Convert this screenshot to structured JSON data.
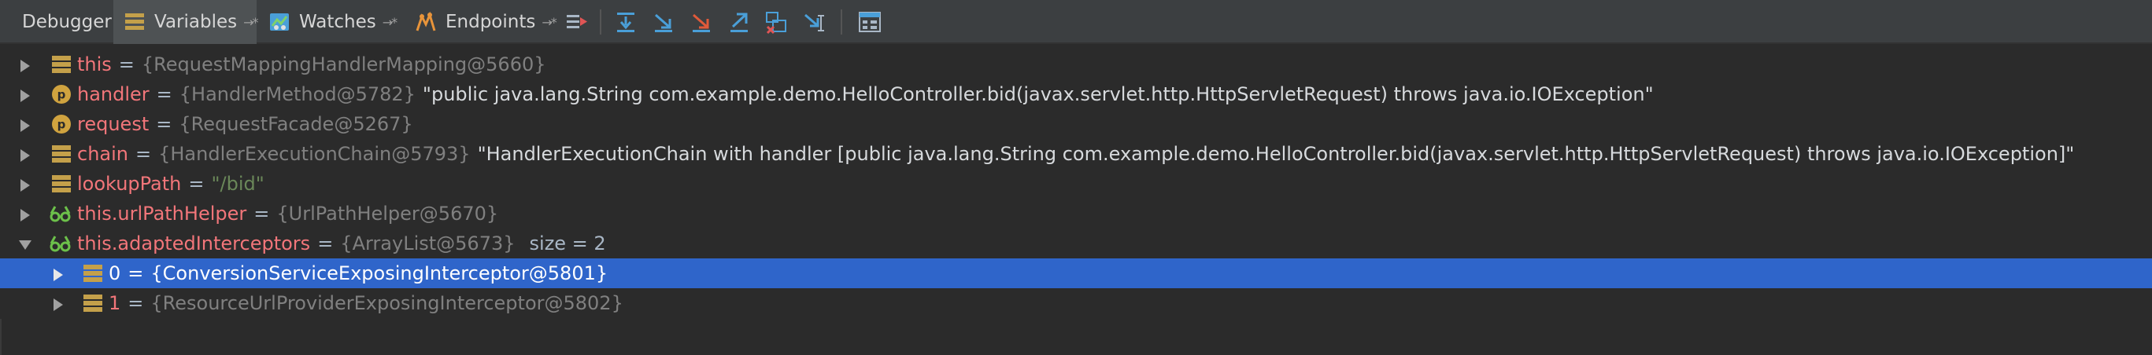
{
  "toolbar": {
    "tabs": [
      {
        "label": "Debugger"
      },
      {
        "label": "Variables",
        "pin": "→*"
      },
      {
        "label": "Watches",
        "pin": "→*"
      },
      {
        "label": "Endpoints",
        "pin": "→*"
      }
    ]
  },
  "variables": [
    {
      "name": "this",
      "eq": "=",
      "value": "{RequestMappingHandlerMapping@5660}",
      "extra": "",
      "expanded": false,
      "icon": "field-icon"
    },
    {
      "name": "handler",
      "eq": "=",
      "value": "{HandlerMethod@5782}",
      "extra": "\"public java.lang.String com.example.demo.HelloController.bid(javax.servlet.http.HttpServletRequest) throws java.io.IOException\"",
      "expanded": false,
      "icon": "parameter-icon"
    },
    {
      "name": "request",
      "eq": "=",
      "value": "{RequestFacade@5267}",
      "extra": "",
      "expanded": false,
      "icon": "parameter-icon"
    },
    {
      "name": "chain",
      "eq": "=",
      "value": "{HandlerExecutionChain@5793}",
      "extra": "\"HandlerExecutionChain with handler [public java.lang.String com.example.demo.HelloController.bid(javax.servlet.http.HttpServletRequest) throws java.io.IOException]\"",
      "expanded": false,
      "icon": "field-icon"
    },
    {
      "name": "lookupPath",
      "eq": "=",
      "value": "\"/bid\"",
      "extra": "",
      "expanded": false,
      "icon": "field-icon"
    },
    {
      "name": "this.urlPathHelper",
      "eq": "=",
      "value": "{UrlPathHelper@5670}",
      "extra": "",
      "expanded": false,
      "icon": "watch-icon"
    },
    {
      "name": "this.adaptedInterceptors",
      "eq": "=",
      "value": "{ArrayList@5673}",
      "extra": "size = 2",
      "expanded": true,
      "icon": "watch-icon"
    },
    {
      "name": "0",
      "eq": "=",
      "value": "{ConversionServiceExposingInterceptor@5801}",
      "extra": "",
      "expanded": false,
      "icon": "field-icon",
      "selected": true
    },
    {
      "name": "1",
      "eq": "=",
      "value": "{ResourceUrlProviderExposingInterceptor@5802}",
      "extra": "",
      "expanded": false,
      "icon": "field-icon"
    }
  ],
  "colors": {
    "background": "#2b2b2b",
    "toolbar": "#3c3f41",
    "selection": "#2f65ca",
    "name": "#f2767a",
    "type": "#808080",
    "string": "#6a8759"
  }
}
